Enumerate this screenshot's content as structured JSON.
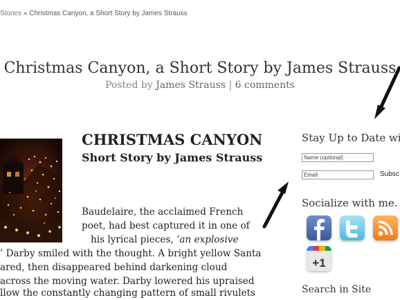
{
  "breadcrumb": {
    "parent": "Stories",
    "separator": "»",
    "current": "Christmas Canyon, a Short Story by James Strauss"
  },
  "post": {
    "title": "Christmas Canyon, a Short Story by James Strauss",
    "meta_prefix": "Posted by",
    "author": "James Strauss",
    "meta_separator": "|",
    "comments": "6 comments"
  },
  "story": {
    "heading": "CHRISTMAS CANYON",
    "subheading": "Short Story by James Strauss",
    "line1": "Baudelaire, the acclaimed French",
    "line2": "poet, had best captured it in one of",
    "line3_a": "his lyrical pieces, ‘",
    "line3_b": "an explosive",
    "line4": "’ Darby smiled with the thought. A bright yellow Santa",
    "line5": "ared, then disappeared behind darkening cloud",
    "line6": "across the moving water. Darby lowered his upraised",
    "line7": "llow the constantly changing pattern of small rivulets"
  },
  "sidebar": {
    "subscribe_heading": "Stay Up to Date with",
    "name_placeholder": "Name (optional)",
    "email_placeholder": "Email",
    "subscribe_label": "Subsc",
    "social_heading": "Socialize with me.",
    "search_heading": "Search in Site"
  },
  "social_icons": [
    "facebook-icon",
    "twitter-icon",
    "rss-icon",
    "google-plus-icon"
  ],
  "colors": {
    "facebook": "#3b5998",
    "twitter": "#5fc4e9",
    "rss": "#f07d1a",
    "google_plus": "#d64937"
  }
}
